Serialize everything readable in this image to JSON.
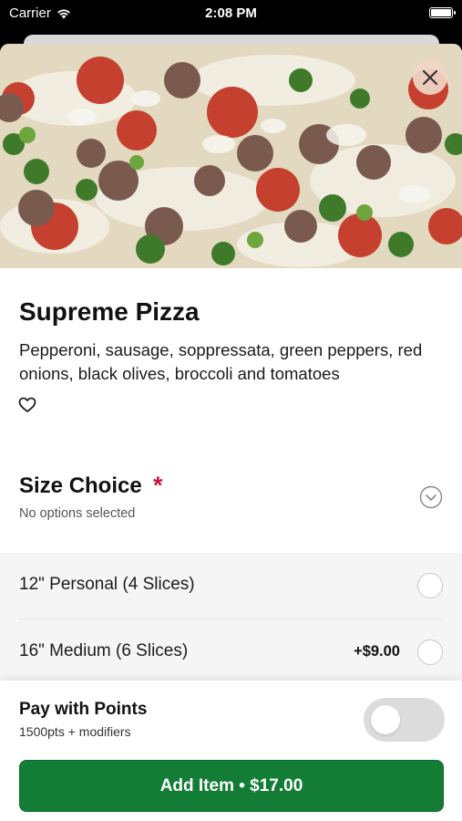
{
  "status_bar": {
    "carrier": "Carrier",
    "time": "2:08 PM"
  },
  "item": {
    "title": "Supreme Pizza",
    "description": "Pepperoni, sausage, soppressata, green peppers, red onions, black olives, broccoli and tomatoes"
  },
  "size_choice": {
    "title": "Size Choice",
    "required_mark": "*",
    "subtitle": "No options selected",
    "options": [
      {
        "label": "12\" Personal (4 Slices)",
        "price": ""
      },
      {
        "label": "16\" Medium (6 Slices)",
        "price": "+$9.00"
      }
    ]
  },
  "pay_with_points": {
    "title": "Pay with Points",
    "subtitle": "1500pts + modifiers",
    "enabled": false
  },
  "add_button": {
    "label": "Add Item • $17.00"
  },
  "colors": {
    "brand_green": "#137d36",
    "required_red": "#c41445",
    "close_button_bg": "#f0d7c8"
  },
  "icons": {
    "close": "close-icon",
    "favorite": "heart-outline-icon",
    "expand": "chevron-down-circle-icon",
    "wifi": "wifi-icon",
    "battery": "battery-icon"
  }
}
